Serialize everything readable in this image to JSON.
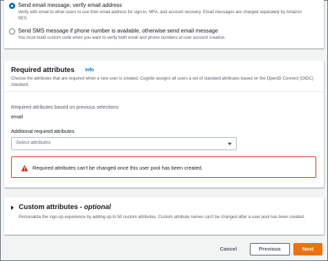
{
  "verification": {
    "option_email": {
      "label": "Send email message, verify email address",
      "desc": "Verify with email to allow users to use their email address for sign-in, MFA, and account recovery. Email messages are charged separately by Amazon SES.",
      "selected": true
    },
    "option_sms": {
      "label": "Send SMS message if phone number is available, otherwise send email message",
      "desc": "You must build custom code when you want to verify both email and phone numbers at user account creation.",
      "selected": false
    }
  },
  "required_attributes": {
    "title": "Required attributes",
    "info": "Info",
    "desc": "Choose the attributes that are required when a new user is created. Cognito assigns all users a set of standard attributes based on the OpenID Connect (OIDC) standard.",
    "previous_label": "Required attributes based on previous selections",
    "previous_value": "email",
    "additional_label": "Additional required attributes",
    "select_placeholder": "Select attributes",
    "alert_text": "Required attributes can't be changed once this user pool has been created.",
    "alert_color": "#d13212"
  },
  "custom_attributes": {
    "title": "Custom attributes - ",
    "title_optional": "optional",
    "desc": "Personalize the sign-up experience by adding up to 50 custom attributes. Custom attribute names can't be changed after a user pool has been created."
  },
  "footer": {
    "cancel": "Cancel",
    "previous": "Previous",
    "next": "Next",
    "accent": "#ec7211"
  }
}
